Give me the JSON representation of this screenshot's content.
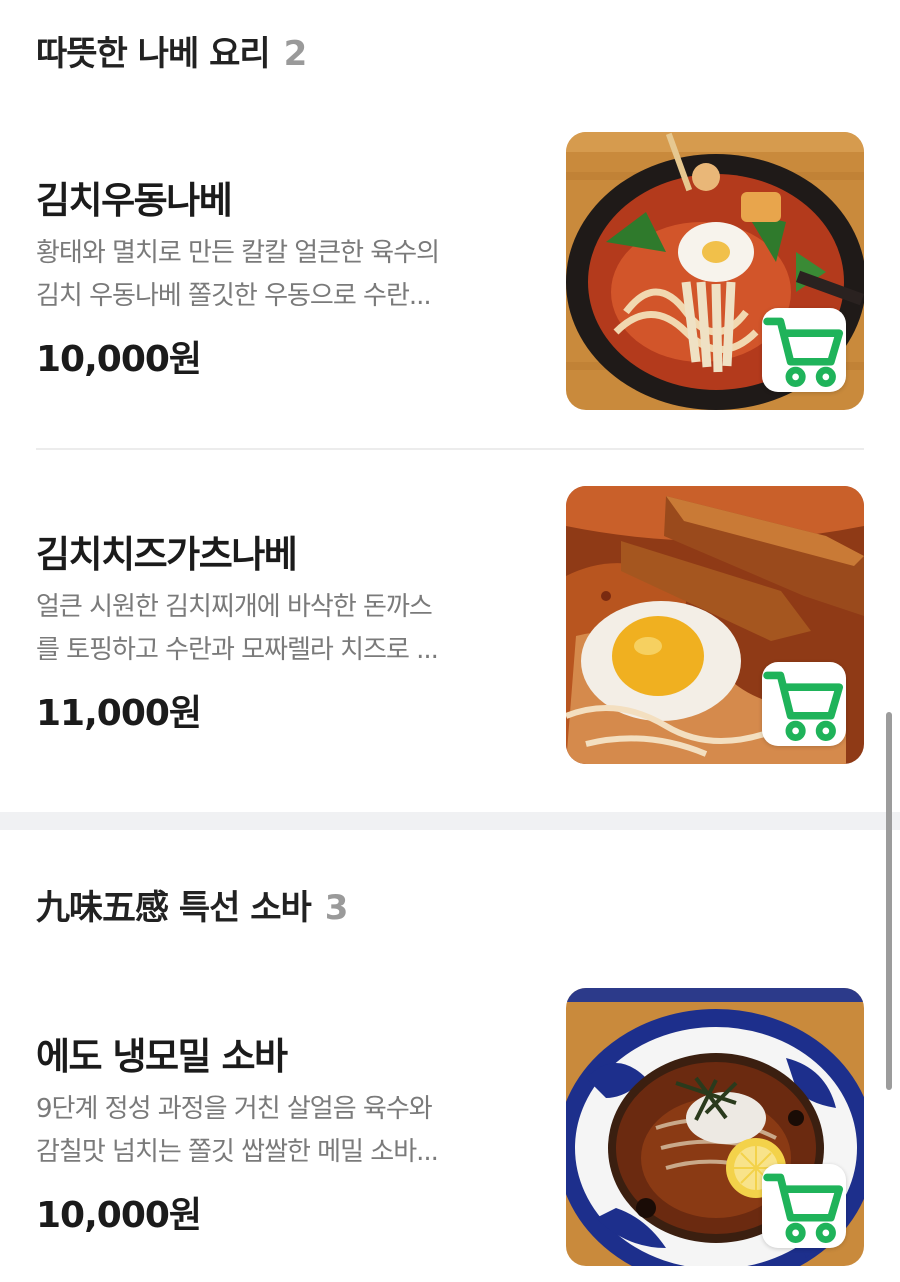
{
  "sections": [
    {
      "title": "따뜻한 나베 요리",
      "count": "2",
      "items": [
        {
          "name": "김치우동나베",
          "desc_line1": "황태와 멸치로 만든 칼칼 얼큰한 육수의",
          "desc_line2": "김치 우동나베 쫄깃한 우동으로 수란...",
          "price": "10,000원"
        },
        {
          "name": "김치치즈가츠나베",
          "desc_line1": "얼큰 시원한 김치찌개에 바삭한 돈까스",
          "desc_line2": "를 토핑하고 수란과 모짜렐라 치즈로 ...",
          "price": "11,000원"
        }
      ]
    },
    {
      "title": "九味五感 특선 소바",
      "count": "3",
      "items": [
        {
          "name": "에도 냉모밀 소바",
          "desc_line1": "9단계 정성 과정을 거친 살얼음 육수와",
          "desc_line2": "감칠맛 넘치는 쫄깃 쌉쌀한 메밀 소바...",
          "price": "10,000원"
        }
      ]
    }
  ],
  "icons": {
    "cart": "cart-icon"
  },
  "colors": {
    "accent": "#1fb35a",
    "divider": "#ececec",
    "section_gap": "#f0f1f3"
  }
}
